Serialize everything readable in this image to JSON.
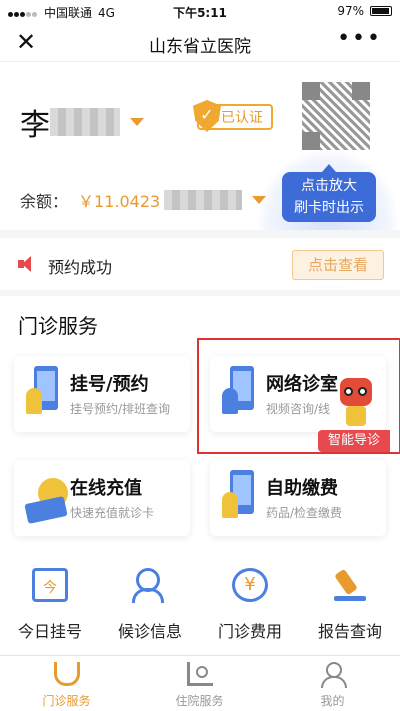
{
  "status_bar": {
    "carrier": "中国联通",
    "network": "4G",
    "time": "下午5:11",
    "battery": "97%"
  },
  "nav": {
    "title": "山东省立医院",
    "close_icon": "close-icon",
    "more_icon": "more-icon"
  },
  "profile": {
    "name_visible": "李",
    "verified_label": "已认证",
    "balance_label": "余额：",
    "balance_value_visible": "￥11.0423",
    "tooltip_line1": "点击放大",
    "tooltip_line2": "刷卡时出示"
  },
  "notice": {
    "text": "预约成功",
    "action_label": "点击查看"
  },
  "services": {
    "section_title": "门诊服务",
    "tiles": [
      {
        "title": "挂号/预约",
        "subtitle": "挂号预约/排班查询"
      },
      {
        "title": "网络诊室",
        "subtitle": "视频咨询/线",
        "badge": "智能导诊"
      },
      {
        "title": "在线充值",
        "subtitle": "快速充值就诊卡"
      },
      {
        "title": "自助缴费",
        "subtitle": "药品/检查缴费"
      }
    ],
    "quick": [
      {
        "label": "今日挂号",
        "icon": "calendar-icon"
      },
      {
        "label": "候诊信息",
        "icon": "waiting-people-icon"
      },
      {
        "label": "门诊费用",
        "icon": "yen-search-icon"
      },
      {
        "label": "报告查询",
        "icon": "microscope-icon"
      }
    ]
  },
  "tabs": [
    {
      "label": "门诊服务",
      "icon": "stethoscope-icon",
      "active": true
    },
    {
      "label": "住院服务",
      "icon": "hospital-bed-icon",
      "active": false
    },
    {
      "label": "我的",
      "icon": "person-icon",
      "active": false
    }
  ],
  "colors": {
    "accent": "#e89a2e",
    "primary_blue": "#4b7fe0",
    "alert_red": "#e8494f"
  }
}
